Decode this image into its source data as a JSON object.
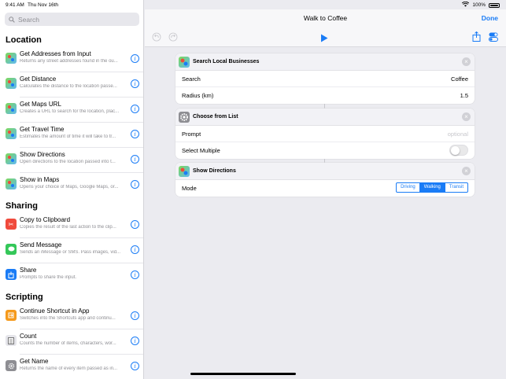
{
  "status": {
    "time": "9:41 AM",
    "date": "Thu Nov 16th",
    "battery": "100%"
  },
  "search": {
    "placeholder": "Search"
  },
  "sections": {
    "location": "Location",
    "sharing": "Sharing",
    "scripting": "Scripting"
  },
  "location_items": [
    {
      "title": "Get Addresses from Input",
      "sub": "Returns any street addresses found in the ou...",
      "icon": "maps-icon"
    },
    {
      "title": "Get Distance",
      "sub": "Calculates the distance to the location passe...",
      "icon": "maps-icon"
    },
    {
      "title": "Get Maps URL",
      "sub": "Creates a URL to search for the location, plac...",
      "icon": "maps-icon"
    },
    {
      "title": "Get Travel Time",
      "sub": "Estimates the amount of time it will take to tr...",
      "icon": "maps-icon"
    },
    {
      "title": "Show Directions",
      "sub": "Open directions to the location passed into t...",
      "icon": "maps-icon"
    },
    {
      "title": "Show in Maps",
      "sub": "Opens your choice of Maps, Google Maps, or...",
      "icon": "maps-icon"
    }
  ],
  "sharing_items": [
    {
      "title": "Copy to Clipboard",
      "sub": "Copies the result of the last action to the clip...",
      "icon": "clipboard-icon"
    },
    {
      "title": "Send Message",
      "sub": "Sends an iMessage or SMS. Pass images, vid...",
      "icon": "message-icon"
    },
    {
      "title": "Share",
      "sub": "Prompts to share the input.",
      "icon": "share-icon"
    }
  ],
  "scripting_items": [
    {
      "title": "Continue Shortcut in App",
      "sub": "Switches into the Shortcuts app and continu...",
      "icon": "continue-icon"
    },
    {
      "title": "Count",
      "sub": "Counts the number of items, characters, wor...",
      "icon": "count-icon"
    },
    {
      "title": "Get Name",
      "sub": "Returns the name of every item passed as in...",
      "icon": "gear-icon"
    }
  ],
  "editor": {
    "title": "Walk to Coffee",
    "done": "Done"
  },
  "cards": {
    "search_local": {
      "name": "Search Local Businesses",
      "search_label": "Search",
      "search_value": "Coffee",
      "radius_label": "Radius (km)",
      "radius_value": "1.5"
    },
    "choose_list": {
      "name": "Choose from List",
      "prompt_label": "Prompt",
      "prompt_placeholder": "optional",
      "multiple_label": "Select Multiple",
      "multiple_on": false
    },
    "show_directions": {
      "name": "Show Directions",
      "mode_label": "Mode",
      "modes": [
        "Driving",
        "Walking",
        "Transit"
      ],
      "selected_mode": "Walking"
    }
  },
  "colors": {
    "accent": "#1a7cf6",
    "red": "#f04a3c",
    "green": "#34c759"
  }
}
